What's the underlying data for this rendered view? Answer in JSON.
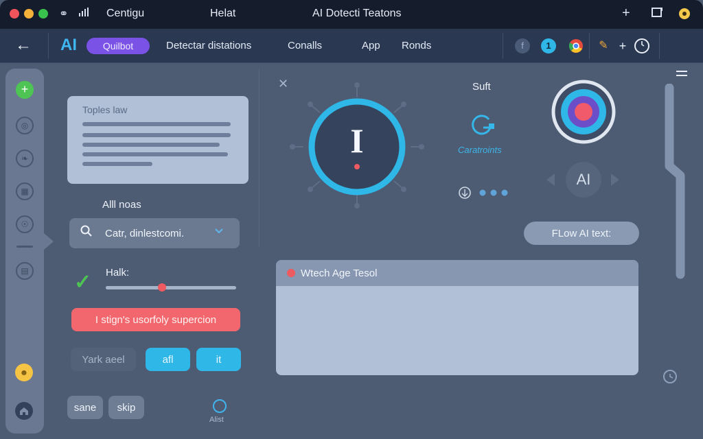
{
  "window": {
    "tab1": "Centigu",
    "tab2": "Helat",
    "title": "AI Dotecti Teatons"
  },
  "toolbar": {
    "logo": "AI",
    "badge": "Quilbot",
    "nav": [
      "Detectar distations",
      "Conalls",
      "App",
      "Ronds"
    ],
    "add": "+"
  },
  "left": {
    "topics_title": "Toples law",
    "all_label": "Alll noas",
    "search_value": "Catr, dinlestcomi.",
    "slider_label": "Halk:",
    "slider_value": 0.43,
    "red_button": "I stign's usorfoly supercion",
    "btn_dark": "Yark aeel",
    "btn_cyan1": "afl",
    "btn_cyan2": "it",
    "btn_save": "sane",
    "btn_skip": "skip",
    "alert_label": "Alist"
  },
  "center": {
    "ring_letter": "I",
    "suft": "Suft",
    "g_label": "Caratroints",
    "ai_bubble": "AI",
    "flow_pill": "FLow AI text:",
    "card_title": "Wtech Age Tesol"
  },
  "colors": {
    "accent_cyan": "#2fb7e8",
    "accent_purple": "#7a52e6",
    "accent_red": "#f1676d",
    "success_green": "#4ec454"
  }
}
